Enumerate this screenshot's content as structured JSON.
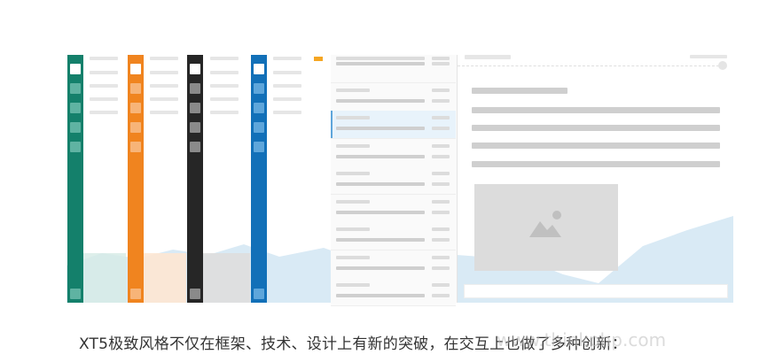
{
  "caption": "XT5极致风格不仅在框架、技术、设计上有新的突破，在交互上也做了多种创新：",
  "watermark": "www.thinkphp.com",
  "themes": [
    {
      "name": "teal",
      "color": "#14806b",
      "chip": "#5fb3a2"
    },
    {
      "name": "orange",
      "color": "#f0841f",
      "chip": "#f7b478"
    },
    {
      "name": "black",
      "color": "#262626",
      "chip": "#8a8a8a"
    },
    {
      "name": "blue",
      "color": "#1270b8",
      "chip": "#5ea6db"
    }
  ],
  "accent": "#f5a623",
  "colors": {
    "background_hills": "#d7e8f3"
  },
  "icons": [
    "image-placeholder-icon"
  ]
}
